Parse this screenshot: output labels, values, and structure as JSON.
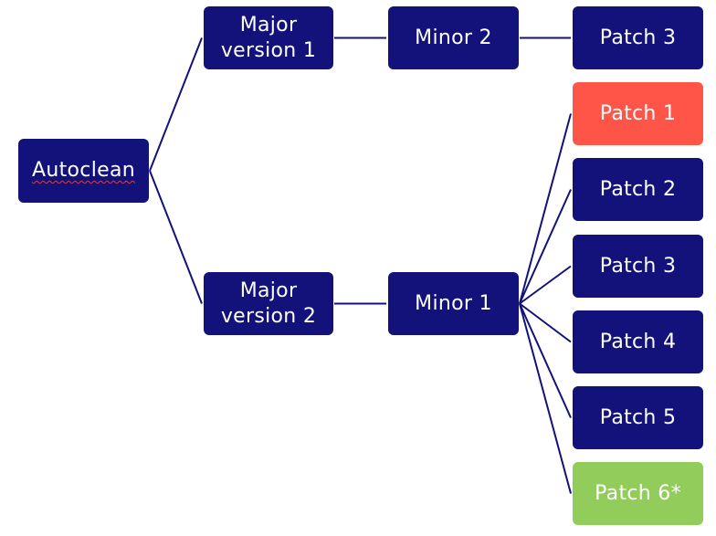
{
  "colors": {
    "node": "#12127a",
    "highlight_red": "#ff5549",
    "highlight_green": "#92cc5a",
    "link": "#12127a"
  },
  "nodes": {
    "root": {
      "label": "Autoclean",
      "spellcheck_flag": true
    },
    "major1": {
      "label": "Major\nversion 1"
    },
    "major2": {
      "label": "Major\nversion 2"
    },
    "minor2": {
      "label": "Minor 2"
    },
    "minor1": {
      "label": "Minor 1"
    },
    "m1_patch3": {
      "label": "Patch 3"
    },
    "patch1": {
      "label": "Patch 1",
      "status": "red"
    },
    "patch2": {
      "label": "Patch 2"
    },
    "patch3": {
      "label": "Patch 3"
    },
    "patch4": {
      "label": "Patch 4"
    },
    "patch5": {
      "label": "Patch 5"
    },
    "patch6": {
      "label": "Patch 6*",
      "status": "green"
    }
  },
  "edges": [
    [
      "root",
      "major1"
    ],
    [
      "root",
      "major2"
    ],
    [
      "major1",
      "minor2"
    ],
    [
      "minor2",
      "m1_patch3"
    ],
    [
      "major2",
      "minor1"
    ],
    [
      "minor1",
      "patch1"
    ],
    [
      "minor1",
      "patch2"
    ],
    [
      "minor1",
      "patch3"
    ],
    [
      "minor1",
      "patch4"
    ],
    [
      "minor1",
      "patch5"
    ],
    [
      "minor1",
      "patch6"
    ]
  ]
}
